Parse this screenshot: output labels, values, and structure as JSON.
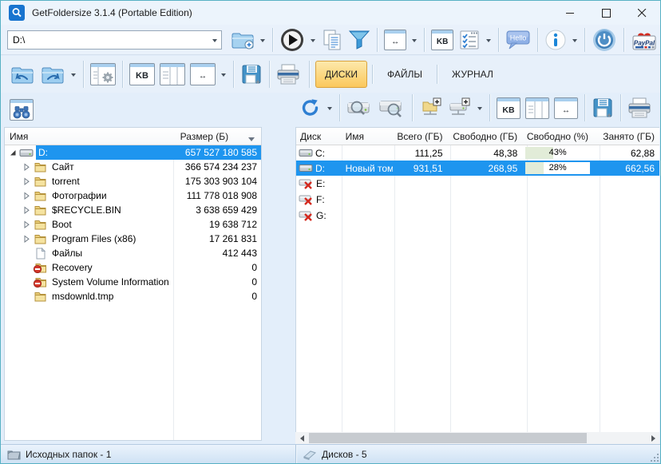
{
  "window": {
    "title": "GetFoldersize 3.1.4 (Portable Edition)",
    "colors": {
      "selection": "#1e95ef",
      "tab_active": "#fbc85c",
      "progress_fill": "#e2ecd8",
      "frame": "#57b1c4"
    }
  },
  "toolbar": {
    "path_value": "D:\\",
    "kb_label": "KB",
    "width_label": "↔",
    "hello_label": "Hello",
    "paypal_label": "PayPal"
  },
  "tabs": {
    "disks": "ДИСКИ",
    "files": "ФАЙЛЫ",
    "journal": "ЖУРНАЛ"
  },
  "folders": {
    "columns": {
      "name": "Имя",
      "size": "Размер (Б)"
    },
    "rows": [
      {
        "name": "D:",
        "size": "657 527 180 585",
        "icon": "drive",
        "expander": "expanded",
        "level": 0,
        "selected": true
      },
      {
        "name": "Сайт",
        "size": "366 574 234 237",
        "icon": "folder",
        "expander": "collapsed",
        "level": 1,
        "selected": false
      },
      {
        "name": "torrent",
        "size": "175 303 903 104",
        "icon": "folder",
        "expander": "collapsed",
        "level": 1,
        "selected": false
      },
      {
        "name": "Фотографии",
        "size": "111 778 018 908",
        "icon": "folder",
        "expander": "collapsed",
        "level": 1,
        "selected": false
      },
      {
        "name": "$RECYCLE.BIN",
        "size": "3 638 659 429",
        "icon": "folder",
        "expander": "collapsed",
        "level": 1,
        "selected": false
      },
      {
        "name": "Boot",
        "size": "19 638 712",
        "icon": "folder",
        "expander": "collapsed",
        "level": 1,
        "selected": false
      },
      {
        "name": "Program Files (x86)",
        "size": "17 261 831",
        "icon": "folder",
        "expander": "collapsed",
        "level": 1,
        "selected": false
      },
      {
        "name": "Файлы",
        "size": "412 443",
        "icon": "file",
        "expander": "none",
        "level": 1,
        "selected": false
      },
      {
        "name": "Recovery",
        "size": "0",
        "icon": "folder-denied",
        "expander": "none",
        "level": 1,
        "selected": false
      },
      {
        "name": "System Volume Information",
        "size": "0",
        "icon": "folder-denied",
        "expander": "none",
        "level": 1,
        "selected": false
      },
      {
        "name": "msdownld.tmp",
        "size": "0",
        "icon": "folder",
        "expander": "none",
        "level": 1,
        "selected": false
      }
    ],
    "status": "Исходных папок - 1"
  },
  "drives": {
    "columns": [
      "Диск",
      "Имя",
      "Всего (ГБ)",
      "Свободно (ГБ)",
      "Свободно (%)",
      "Занято (ГБ)"
    ],
    "rows": [
      {
        "disk": "C:",
        "name": "",
        "total": "111,25",
        "free": "48,38",
        "free_pct_label": "43%",
        "free_pct": 43,
        "used": "62,88",
        "icon": "drive",
        "selected": false
      },
      {
        "disk": "D:",
        "name": "Новый том",
        "total": "931,51",
        "free": "268,95",
        "free_pct_label": "28%",
        "free_pct": 28,
        "used": "662,56",
        "icon": "drive",
        "selected": true
      },
      {
        "disk": "E:",
        "name": "",
        "total": "",
        "free": "",
        "free_pct_label": "",
        "free_pct": null,
        "used": "",
        "icon": "drive-error",
        "selected": false
      },
      {
        "disk": "F:",
        "name": "",
        "total": "",
        "free": "",
        "free_pct_label": "",
        "free_pct": null,
        "used": "",
        "icon": "drive-error",
        "selected": false
      },
      {
        "disk": "G:",
        "name": "",
        "total": "",
        "free": "",
        "free_pct_label": "",
        "free_pct": null,
        "used": "",
        "icon": "drive-error",
        "selected": false
      }
    ],
    "status": "Дисков - 5"
  }
}
